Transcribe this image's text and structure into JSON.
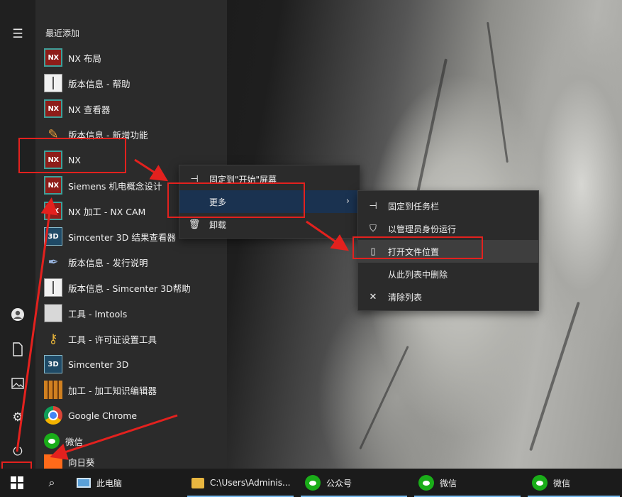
{
  "start_menu": {
    "section_title": "最近添加",
    "apps": [
      {
        "label": "NX 布局",
        "icon": "nx-icon"
      },
      {
        "label": "版本信息 - 帮助",
        "icon": "book-icon"
      },
      {
        "label": "NX 查看器",
        "icon": "nx-icon"
      },
      {
        "label": "版本信息 - 新增功能",
        "icon": "pencil-icon"
      },
      {
        "label": "NX",
        "icon": "nx-icon"
      },
      {
        "label": "Siemens 机电概念设计",
        "icon": "nx-icon"
      },
      {
        "label": "NX 加工 - NX CAM",
        "icon": "nx-icon"
      },
      {
        "label": "Simcenter 3D 结果查看器",
        "icon": "simcenter-3d-icon"
      },
      {
        "label": "版本信息 - 发行说明",
        "icon": "pen-icon"
      },
      {
        "label": "版本信息 - Simcenter 3D帮助",
        "icon": "book-icon"
      },
      {
        "label": "工具 - lmtools",
        "icon": "tool-icon"
      },
      {
        "label": "工具 - 许可证设置工具",
        "icon": "key-icon"
      },
      {
        "label": "Simcenter 3D",
        "icon": "simcenter-3d-icon"
      },
      {
        "label": "加工 - 加工知识编辑器",
        "icon": "grid-icon"
      },
      {
        "label": "Google Chrome",
        "icon": "chrome-icon"
      },
      {
        "label": "微信",
        "icon": "wechat-icon"
      },
      {
        "label": "向日葵",
        "icon": "sunflower-icon"
      }
    ],
    "nx_badge": "NX",
    "s3d_badge": "3D"
  },
  "context_menu_1": {
    "items": [
      {
        "label": "固定到\"开始\"屏幕",
        "icon": "pin-icon"
      },
      {
        "label": "更多",
        "icon": ""
      },
      {
        "label": "卸载",
        "icon": "trash-icon"
      }
    ]
  },
  "context_menu_2": {
    "items": [
      {
        "label": "固定到任务栏",
        "icon": "pin-icon"
      },
      {
        "label": "以管理员身份运行",
        "icon": "shield-icon"
      },
      {
        "label": "打开文件位置",
        "icon": "file-icon"
      },
      {
        "label": "从此列表中删除",
        "icon": ""
      },
      {
        "label": "清除列表",
        "icon": "close-icon"
      }
    ]
  },
  "taskbar": {
    "items": [
      {
        "label": "此电脑",
        "icon": "computer-icon"
      },
      {
        "label": "C:\\Users\\Adminis...",
        "icon": "folder-icon"
      },
      {
        "label": "公众号",
        "icon": "wechat-icon"
      },
      {
        "label": "微信",
        "icon": "wechat-icon"
      },
      {
        "label": "微信",
        "icon": "wechat-icon"
      }
    ]
  },
  "colors": {
    "annotation_red": "#e3211e",
    "menu_bg": "#2b2b2b",
    "selected_bg": "#1a3250"
  }
}
